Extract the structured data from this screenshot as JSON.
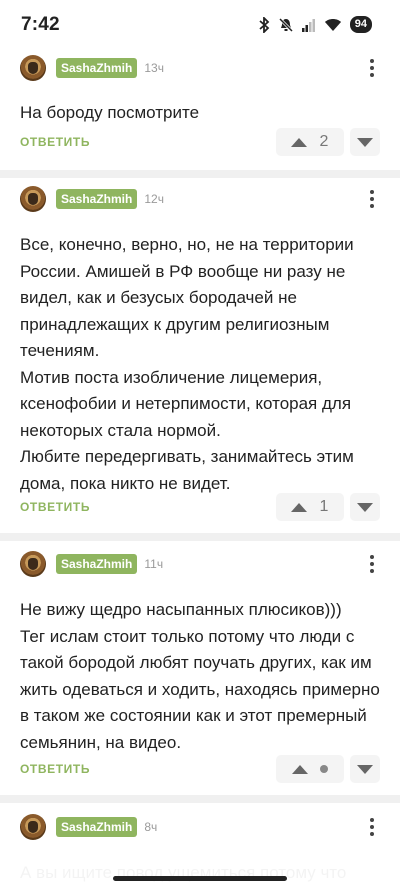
{
  "status_bar": {
    "time": "7:42",
    "battery": "94"
  },
  "comments": [
    {
      "author": "SashaZhmih",
      "time": "13ч",
      "text": "На бороду посмотрите",
      "reply_label": "ОТВЕТИТЬ",
      "rating": "2"
    },
    {
      "author": "SashaZhmih",
      "time": "12ч",
      "text": "Все, конечно, верно, но, не на территории России. Амишей в РФ вообще ни разу не видел, как и безусых бородачей не принадлежащих к другим религиозным течениям.\nМотив поста изобличение лицемерия, ксенофобии и нетерпимости, которая для некоторых стала нормой.\nЛюбите передергивать, занимайтесь этим дома, пока никто не видет.",
      "reply_label": "ОТВЕТИТЬ",
      "rating": "1"
    },
    {
      "author": "SashaZhmih",
      "time": "11ч",
      "text": "Не вижу щедро насыпанных плюсиков)))\nТег ислам стоит только потому что люди с такой бородой любят поучать других, как им жить одеваться и ходить, находясь примерно в таком же состоянии как и этот премерный семьянин, на видео.",
      "reply_label": "ОТВЕТИТЬ",
      "rating": ""
    },
    {
      "author": "SashaZhmih",
      "time": "8ч",
      "text": "А вы ищите повод ущемиться потому что",
      "reply_label": "",
      "rating": ""
    }
  ]
}
